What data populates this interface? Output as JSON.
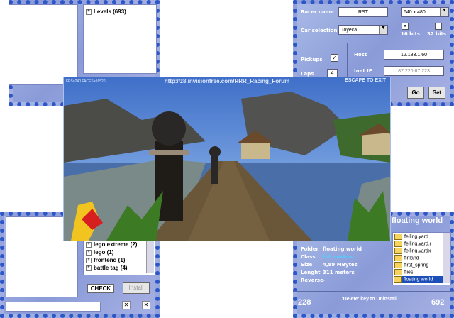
{
  "levels_panel": {
    "tree_label": "Levels (693)"
  },
  "settings": {
    "racer_name_label": "Racer name",
    "racer_name_value": "RST",
    "resolution_value": "640 x 480",
    "car_selection_label": "Car selection",
    "car_selection_value": "Toyeca",
    "bits16_label": "16 bits",
    "bits32_label": "32 bits",
    "pickups_label": "Pickups",
    "laps_label": "Laps",
    "laps_value": "4",
    "host_label": "Host",
    "host_value": "12.183.1.60",
    "inet_label": "Inet IP",
    "inet_value": "87.220.67.223",
    "go_label": "Go",
    "set_label": "Set"
  },
  "game": {
    "fps_text": "FPS=240 FACES=16526",
    "url": "http://z8.invisionfree.com/RRR_Racing_Forum",
    "escape_label": "ESCAPE TO EXIT"
  },
  "tracks": {
    "items": [
      "lego extreme (2)",
      "lego (1)",
      "frontend (1)",
      "battle tag (4)"
    ],
    "check_label": "CHECK",
    "install_label": "Install"
  },
  "info": {
    "title": "floating world",
    "folder_label": "Folder",
    "folder_value": "floating world",
    "class_label": "Class",
    "class_value": "full custom",
    "size_label": "Size",
    "size_value": "4,89 MBytes",
    "length_label": "Lenght",
    "length_value": "311 meters",
    "reverse_label": "Reverse",
    "reverse_value": "-",
    "folders": [
      "felling.yard",
      "felling.yard.r",
      "felling.yardx",
      "finland",
      "first_spring",
      "flies",
      "floating world"
    ],
    "count_left": "228",
    "count_right": "692",
    "uninstall_hint": "'Delete' key to Uninstall"
  }
}
